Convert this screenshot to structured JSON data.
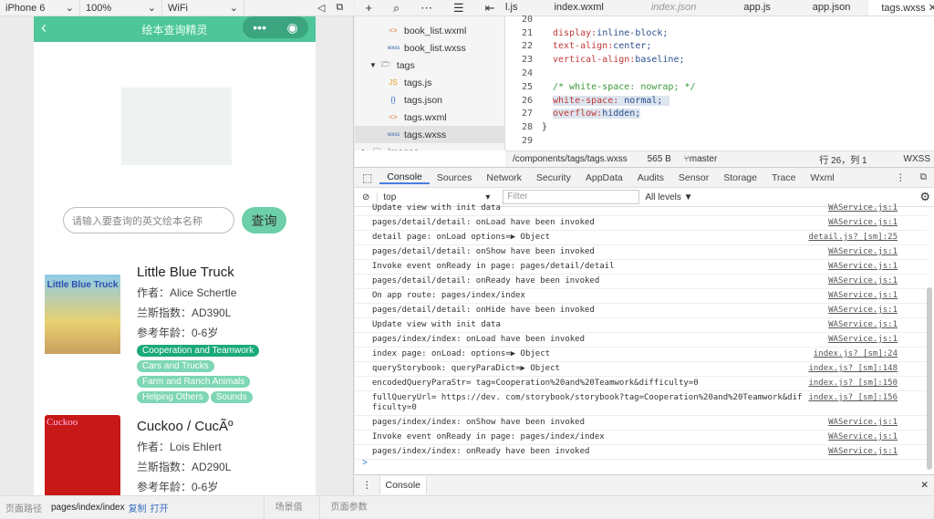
{
  "sim_toolbar": {
    "device": "iPhone 6",
    "zoom": "100%",
    "network": "WiFi"
  },
  "phone": {
    "nav_title": "绘本查询精灵",
    "search_placeholder": "请输入要查询的英文绘本名称",
    "query_button": "查询",
    "books": [
      {
        "title": "Little Blue Truck",
        "author": "作者：Alice Schertle",
        "lexile": "兰斯指数：AD390L",
        "age": "参考年龄：0-6岁",
        "cover_text": "Little Blue Truck",
        "tags": [
          "Cooperation and Teamwork",
          "Cars and Trucks",
          "Farm and Ranch Animals",
          "Helping Others",
          "Sounds"
        ],
        "active_tag": 0
      },
      {
        "title": "Cuckoo / CucÃº",
        "author": "作者：Lois Ehlert",
        "lexile": "兰斯指数：AD290L",
        "age": "参考年龄：0-6岁",
        "cover_text": "Cuckoo",
        "tags": []
      }
    ]
  },
  "editor": {
    "tabs": [
      {
        "label": "l.js"
      },
      {
        "label": "index.wxml"
      },
      {
        "label": "index.json"
      },
      {
        "label": "app.js"
      },
      {
        "label": "app.json"
      },
      {
        "label": "tags.wxss"
      }
    ],
    "active_tab": "tags.wxss",
    "tree": [
      {
        "icon": "<>",
        "label": "book_list.wxml"
      },
      {
        "icon": "wxss",
        "label": "book_list.wxss"
      },
      {
        "icon": "folder",
        "label": "tags"
      },
      {
        "icon": "JS",
        "label": "tags.js"
      },
      {
        "icon": "{}",
        "label": "tags.json"
      },
      {
        "icon": "<>",
        "label": "tags.wxml"
      },
      {
        "icon": "wxss",
        "label": "tags.wxss"
      },
      {
        "icon": "folder",
        "label": "images"
      }
    ],
    "code": [
      {
        "n": "20",
        "prop": "",
        "val": ""
      },
      {
        "n": "21",
        "prop": "display:",
        "val": " inline-block;"
      },
      {
        "n": "22",
        "prop": "text-align:",
        "val": " center;"
      },
      {
        "n": "23",
        "prop": "vertical-align:",
        "val": " baseline;"
      },
      {
        "n": "24",
        "prop": "",
        "val": ""
      },
      {
        "n": "25",
        "comment": "/* white-space: nowrap; */"
      },
      {
        "n": "26",
        "prop": "white-space:",
        "val": " normal;"
      },
      {
        "n": "27",
        "prop": "overflow:",
        "val": "hidden;"
      },
      {
        "n": "28",
        "brace": "}"
      },
      {
        "n": "29",
        "prop": "",
        "val": ""
      }
    ],
    "status": {
      "path": "/components/tags/tags.wxss",
      "size": "565 B",
      "branch": "master",
      "position": "行 26，列 1",
      "lang": "WXSS"
    }
  },
  "console": {
    "tabs": [
      "Console",
      "Sources",
      "Network",
      "Security",
      "AppData",
      "Audits",
      "Sensor",
      "Storage",
      "Trace",
      "Wxml"
    ],
    "context": "top",
    "filter_placeholder": "Filter",
    "levels": "All levels ▼",
    "logs": [
      {
        "msg": "Update view with init data",
        "src": "WAService.js:1"
      },
      {
        "msg": "pages/detail/detail: onLoad have been invoked",
        "src": "WAService.js:1"
      },
      {
        "msg": "detail page: onLoad options=▶ Object",
        "src": "detail.js? [sm]:25"
      },
      {
        "msg": "pages/detail/detail: onShow have been invoked",
        "src": "WAService.js:1"
      },
      {
        "msg": "Invoke event onReady in page: pages/detail/detail",
        "src": "WAService.js:1"
      },
      {
        "msg": "pages/detail/detail: onReady have been invoked",
        "src": "WAService.js:1"
      },
      {
        "msg": "On app route: pages/index/index",
        "src": "WAService.js:1"
      },
      {
        "msg": "pages/detail/detail: onHide have been invoked",
        "src": "WAService.js:1"
      },
      {
        "msg": "Update view with init data",
        "src": "WAService.js:1"
      },
      {
        "msg": "pages/index/index: onLoad have been invoked",
        "src": "WAService.js:1"
      },
      {
        "msg": "index page: onLoad: options=▶ Object",
        "src": "index.js? [sm]:24"
      },
      {
        "msg": "queryStorybook: queryParaDict=▶ Object",
        "src": "index.js? [sm]:148"
      },
      {
        "msg": "encodedQueryParaStr= tag=Cooperation%20and%20Teamwork&difficulty=0",
        "src": "index.js? [sm]:150"
      },
      {
        "msg": "fullQueryUrl= https://dev.          com/storybook/storybook?tag=Cooperation%20and%20Teamwork&difficulty=0",
        "src": "index.js? [sm]:156"
      },
      {
        "msg": "pages/index/index: onShow have been invoked",
        "src": "WAService.js:1"
      },
      {
        "msg": "Invoke event onReady in page: pages/index/index",
        "src": "WAService.js:1"
      },
      {
        "msg": "pages/index/index: onReady have been invoked",
        "src": "WAService.js:1"
      }
    ],
    "prompt": ">",
    "drawer_tab": "Console"
  },
  "bottom": {
    "path_label": "页面路径",
    "path": "pages/index/index",
    "copy": "复制",
    "open": "打开",
    "scene": "场景值",
    "params": "页面参数"
  }
}
